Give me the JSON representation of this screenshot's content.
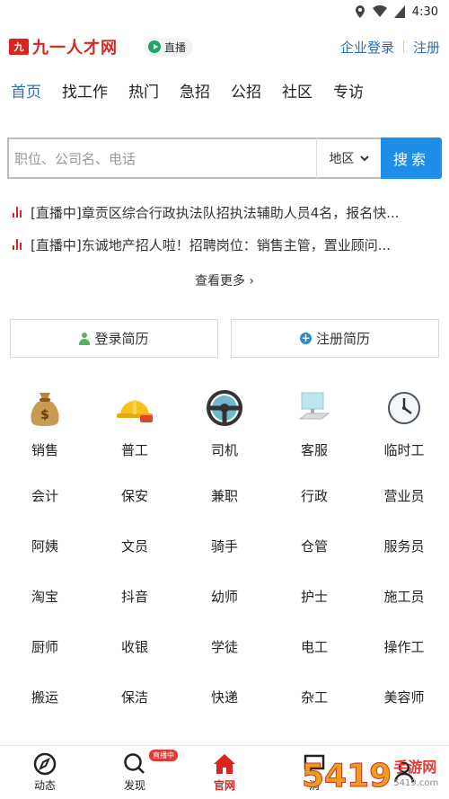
{
  "status": {
    "time": "4:30"
  },
  "header": {
    "logo_mark": "九",
    "logo_text": "九一人才网",
    "live_label": "直播",
    "links": [
      "企业登录",
      "注册"
    ]
  },
  "tabs": [
    "首页",
    "找工作",
    "热门",
    "急招",
    "公招",
    "社区",
    "专访"
  ],
  "search": {
    "placeholder": "职位、公司名、电话",
    "region": "地区",
    "button": "搜索"
  },
  "news": [
    "[直播中]章贡区综合行政执法队招执法辅助人员4名，报名快...",
    "[直播中]东诚地产招人啦！招聘岗位：销售主管，置业顾问..."
  ],
  "more_label": "查看更多",
  "resume": {
    "login": "登录简历",
    "register": "注册简历"
  },
  "icon_categories": [
    {
      "label": "销售",
      "icon": "money-bag-icon"
    },
    {
      "label": "普工",
      "icon": "hard-hat-icon"
    },
    {
      "label": "司机",
      "icon": "steering-wheel-icon"
    },
    {
      "label": "客服",
      "icon": "computer-icon"
    },
    {
      "label": "临时工",
      "icon": "clock-icon"
    }
  ],
  "grid": [
    [
      "会计",
      "保安",
      "兼职",
      "行政",
      "营业员"
    ],
    [
      "阿姨",
      "文员",
      "骑手",
      "仓管",
      "服务员"
    ],
    [
      "淘宝",
      "抖音",
      "幼师",
      "护士",
      "施工员"
    ],
    [
      "厨师",
      "收银",
      "学徒",
      "电工",
      "操作工"
    ],
    [
      "搬运",
      "保洁",
      "快递",
      "杂工",
      "美容师"
    ]
  ],
  "bottom_nav": [
    {
      "label": "动态",
      "icon": "compass-icon"
    },
    {
      "label": "发现",
      "icon": "search-icon",
      "badge": "直播中"
    },
    {
      "label": "官网",
      "icon": "home-icon",
      "active": true
    },
    {
      "label": "消",
      "icon": "message-icon"
    },
    {
      "label": "",
      "icon": "user-icon"
    }
  ],
  "watermark": {
    "big": "5419",
    "small": "手游网",
    "url": "5419.com"
  },
  "colors": {
    "brand": "#d9251d",
    "accent": "#2a6fb5",
    "search_button": "#1f8ee8"
  }
}
